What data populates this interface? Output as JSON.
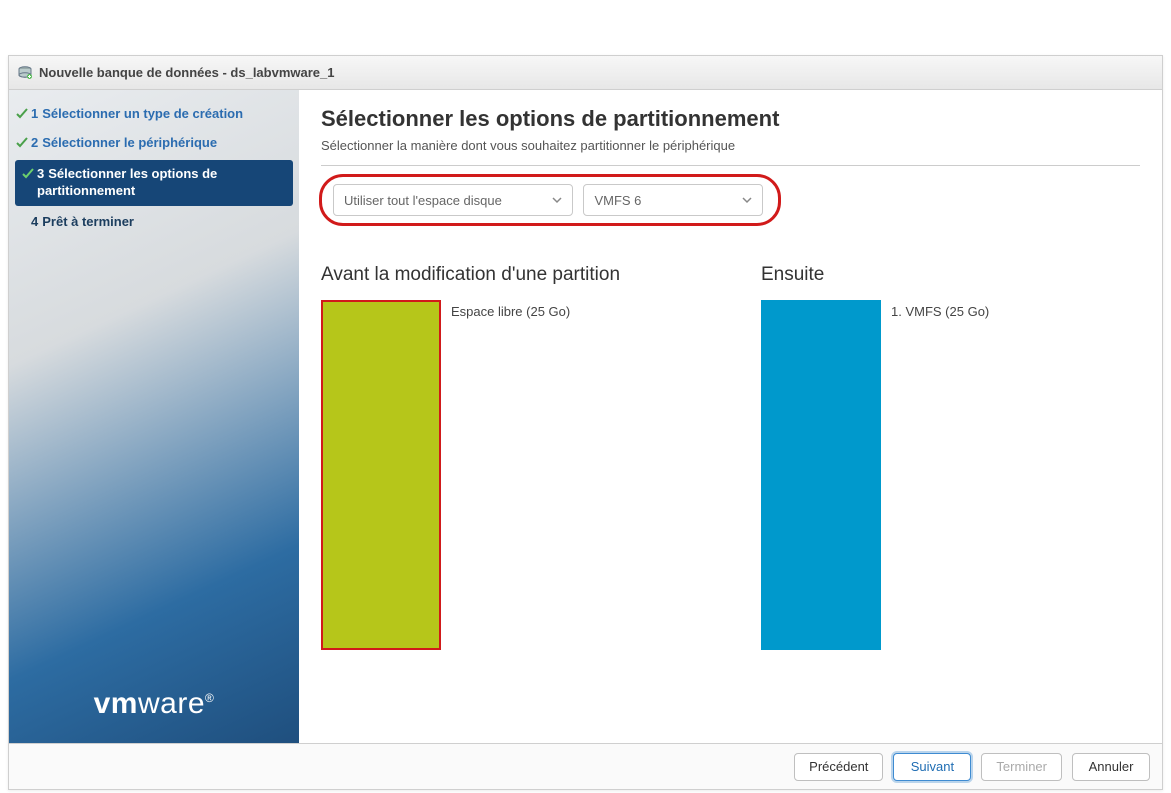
{
  "window": {
    "title": "Nouvelle banque de données - ds_labvmware_1"
  },
  "steps": [
    {
      "num": "1",
      "label": "Sélectionner un type de création",
      "state": "completed"
    },
    {
      "num": "2",
      "label": "Sélectionner le périphérique",
      "state": "completed"
    },
    {
      "num": "3",
      "label": "Sélectionner les options de partitionnement",
      "state": "active"
    },
    {
      "num": "4",
      "label": "Prêt à terminer",
      "state": "pending"
    }
  ],
  "branding": {
    "logo_vm": "vm",
    "logo_ware": "ware",
    "registered": "®"
  },
  "page": {
    "title": "Sélectionner les options de partitionnement",
    "subtitle": "Sélectionner la manière dont vous souhaitez partitionner le périphérique"
  },
  "selects": {
    "partition_scheme": "Utiliser tout l'espace disque",
    "fs_version": "VMFS 6"
  },
  "before": {
    "title": "Avant la modification d'une partition",
    "legend": "Espace libre  (25 Go)"
  },
  "after": {
    "title": "Ensuite",
    "legend": "1. VMFS  (25 Go)"
  },
  "buttons": {
    "back": "Précédent",
    "next": "Suivant",
    "finish": "Terminer",
    "cancel": "Annuler"
  }
}
